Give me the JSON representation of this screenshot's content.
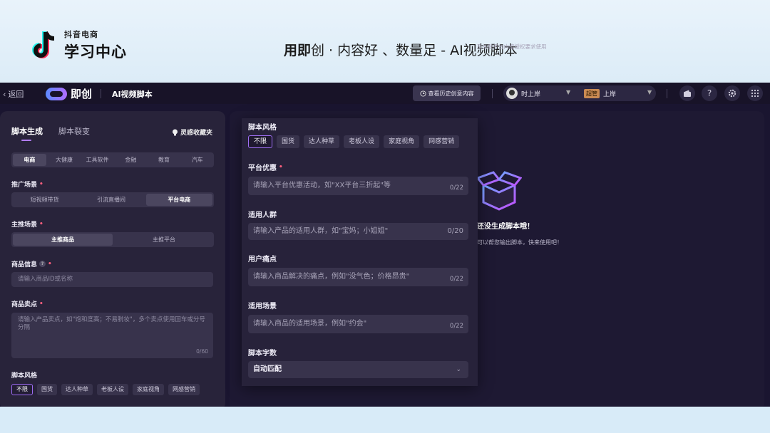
{
  "slide": {
    "brand_sub": "抖音电商",
    "brand_main": "学习中心",
    "title_bold": "用即",
    "title_rest": "创 · 内容好 、数量足 - AI视频脚本"
  },
  "topbar": {
    "back_label": "返回",
    "app_name": "即创",
    "page_title": "AI视频脚本",
    "history_button": "查看历史创意内容",
    "account_name": "时上岸",
    "badge": "超管",
    "account_role": "上岸"
  },
  "left": {
    "tabs": [
      "脚本生成",
      "脚本裂变"
    ],
    "inspire_label": "灵感收藏夹",
    "industries": [
      "电商",
      "大健康",
      "工具软件",
      "金融",
      "教育",
      "汽车"
    ],
    "promo_label": "推广场景",
    "promo_options": [
      "短视频带货",
      "引流直播间",
      "平台电商"
    ],
    "main_label": "主推场景",
    "main_options": [
      "主推商品",
      "主推平台"
    ],
    "product_info_label": "商品信息",
    "product_info_placeholder": "请输入商品ID或名称",
    "selling_label": "商品卖点",
    "selling_placeholder": "请输入产品卖点，如\"饱和度高；不易脱妆\"，多个卖点使用回车或分号分隔",
    "selling_counter": "0/60",
    "style_label": "脚本风格",
    "styles": [
      "不限",
      "国货",
      "达人种草",
      "老板人设",
      "家庭视角",
      "网感营销"
    ]
  },
  "right": {
    "notice": "及关联平台内按授权要求使用",
    "empty_title": "还没生成脚本哦！",
    "empty_desc": "可以帮您输出脚本，快来使用吧！"
  },
  "zoom": {
    "style_label": "脚本风格",
    "styles": [
      "不限",
      "国货",
      "达人种草",
      "老板人设",
      "家庭视角",
      "网感营销"
    ],
    "discount_label": "平台优惠",
    "discount_placeholder": "请输入平台优惠活动，如\"XX平台三折起\"等",
    "discount_counter": "0/22",
    "audience_label": "适用人群",
    "audience_placeholder": "请输入产品的适用人群，如\"宝妈；小姐姐\"",
    "audience_counter": "0/20",
    "pain_label": "用户痛点",
    "pain_placeholder": "请输入商品解决的痛点，例如\"没气色；价格昂贵\"",
    "pain_counter": "0/22",
    "scene_label": "适用场景",
    "scene_placeholder": "请输入商品的适用场景，例如\"约会\"",
    "scene_counter": "0/22",
    "length_label": "脚本字数",
    "length_value": "自动匹配"
  }
}
